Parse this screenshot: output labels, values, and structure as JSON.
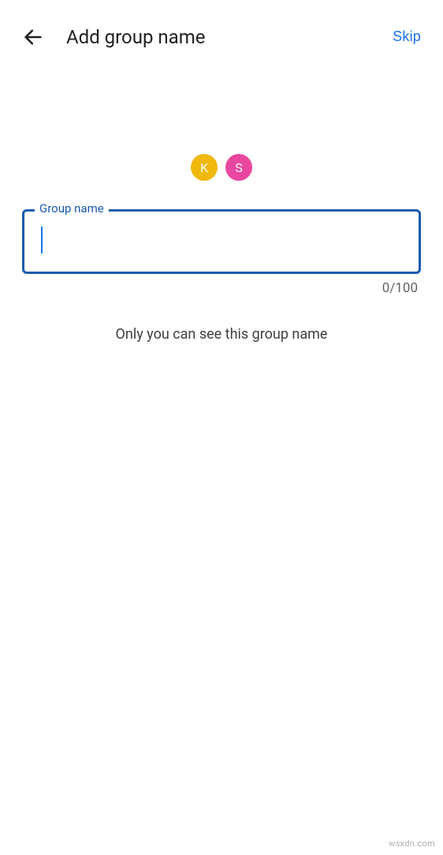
{
  "header": {
    "title": "Add group name",
    "skip_label": "Skip"
  },
  "avatars": [
    {
      "initial": "K",
      "color": "#f1b80d"
    },
    {
      "initial": "S",
      "color": "#e946a0"
    }
  ],
  "input": {
    "label": "Group name",
    "value": "",
    "char_count": "0/100"
  },
  "helper": "Only you can see this group name",
  "watermark": "wsxdn.com"
}
